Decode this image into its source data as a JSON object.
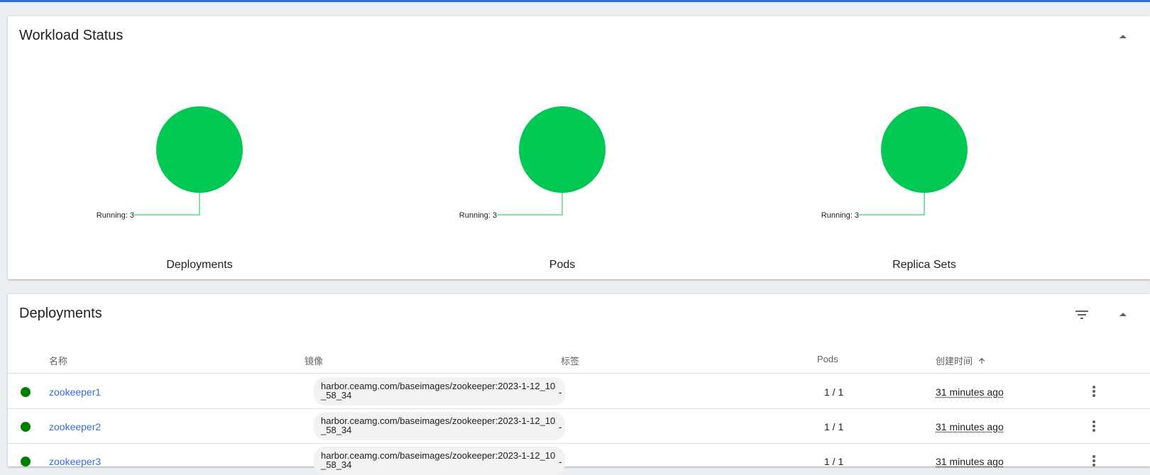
{
  "colors": {
    "accent": "#326de6",
    "running": "#00c853",
    "status_dot": "#008000"
  },
  "workload_status": {
    "title": "Workload Status",
    "collapse_icon": "arrow-drop-up-icon",
    "charts": [
      {
        "caption": "Deployments",
        "legend": "Running: 3",
        "running": 3
      },
      {
        "caption": "Pods",
        "legend": "Running: 3",
        "running": 3
      },
      {
        "caption": "Replica Sets",
        "legend": "Running: 3",
        "running": 3
      }
    ]
  },
  "deployments": {
    "title": "Deployments",
    "filter_icon": "filter-list-icon",
    "collapse_icon": "arrow-drop-up-icon",
    "columns": {
      "name": "名称",
      "images": "镜像",
      "labels": "标签",
      "pods": "Pods",
      "created": "创建时间",
      "sort_icon": "arrow-upward-icon"
    },
    "rows": [
      {
        "status": "running",
        "name": "zookeeper1",
        "image": "harbor.ceamg.com/baseimages/zookeeper:2023-1-12_10_58_34",
        "labels": "-",
        "pods": "1 / 1",
        "created": "31 minutes ago"
      },
      {
        "status": "running",
        "name": "zookeeper2",
        "image": "harbor.ceamg.com/baseimages/zookeeper:2023-1-12_10_58_34",
        "labels": "-",
        "pods": "1 / 1",
        "created": "31 minutes ago"
      },
      {
        "status": "running",
        "name": "zookeeper3",
        "image": "harbor.ceamg.com/baseimages/zookeeper:2023-1-12_10_58_34",
        "labels": "-",
        "pods": "1 / 1",
        "created": "31 minutes ago"
      }
    ]
  }
}
